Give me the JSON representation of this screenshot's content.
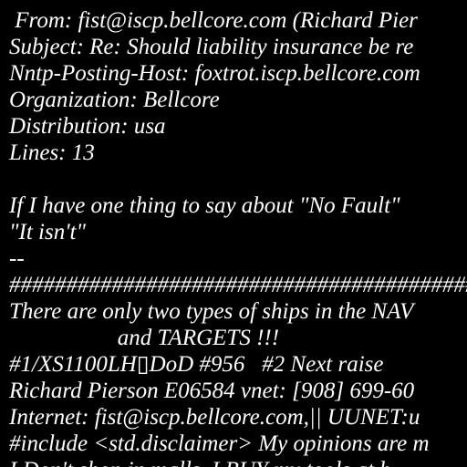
{
  "document": {
    "background_color": "#000000",
    "text_color": "#ffffff",
    "lines": [
      " From: fist@iscp.bellcore.com (Richard Pier",
      "Subject: Re: Should liability insurance be re",
      "Nntp-Posting-Host: foxtrot.iscp.bellcore.com",
      "Organization: Bellcore",
      "Distribution: usa",
      "Lines: 13",
      "",
      "If I have one thing to say about \"No Fault\"",
      "\"It isn't\"",
      "--",
      "################################################################",
      "There are only two types of ships in the NAV",
      "                   and TARGETS !!!",
      "#1/XS1100LH▯DoD #956   #2 Next raise",
      "Richard Pierson E06584 vnet: [908] 699-60",
      "Internet: fist@iscp.bellcore.com,|| UUNET:u",
      "#include <std.disclaimer> My opinions are m",
      "I Don't shop in malls, I BUY my tools at b"
    ]
  }
}
